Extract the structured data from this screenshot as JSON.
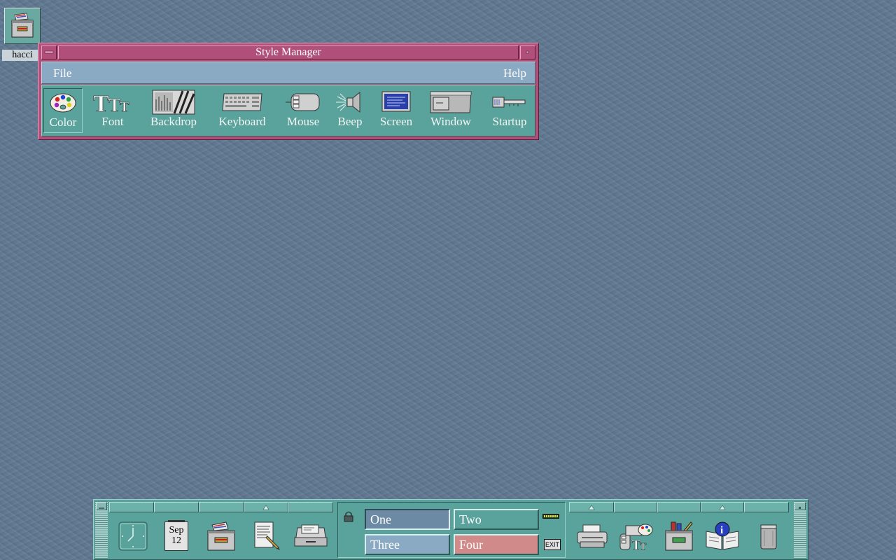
{
  "desktop": {
    "icon": {
      "label": "hacci",
      "icon_name": "file-cabinet-icon"
    }
  },
  "style_manager": {
    "title": "Style Manager",
    "menu": {
      "file": "File",
      "help": "Help"
    },
    "tools": [
      {
        "key": "color",
        "label": "Color",
        "icon_name": "palette-icon",
        "selected": true
      },
      {
        "key": "font",
        "label": "Font",
        "icon_name": "font-ttt-icon",
        "glyph": "TTT"
      },
      {
        "key": "backdrop",
        "label": "Backdrop",
        "icon_name": "backdrop-icon"
      },
      {
        "key": "keyboard",
        "label": "Keyboard",
        "icon_name": "keyboard-icon"
      },
      {
        "key": "mouse",
        "label": "Mouse",
        "icon_name": "mouse-icon"
      },
      {
        "key": "beep",
        "label": "Beep",
        "icon_name": "speaker-icon"
      },
      {
        "key": "screen",
        "label": "Screen",
        "icon_name": "monitor-screen-icon"
      },
      {
        "key": "window",
        "label": "Window",
        "icon_name": "window-icon"
      },
      {
        "key": "startup",
        "label": "Startup",
        "icon_name": "key-icon"
      }
    ],
    "colors": {
      "frame": "#b04f79",
      "menubar": "#8aa9c2",
      "body": "#5aa39c"
    }
  },
  "front_panel": {
    "left_controls": [
      {
        "name": "clock-icon"
      },
      {
        "name": "calendar-icon",
        "month": "Sep",
        "day": "12"
      },
      {
        "name": "file-manager-icon"
      },
      {
        "name": "text-editor-icon"
      },
      {
        "name": "mailbox-icon"
      }
    ],
    "workspaces": [
      {
        "label": "One",
        "color": "#6c8aa4",
        "active": true
      },
      {
        "label": "Two",
        "color": "#5aa39c"
      },
      {
        "label": "Three",
        "color": "#8aa9c2"
      },
      {
        "label": "Four",
        "color": "#d08a8a"
      }
    ],
    "exit_label": "EXIT",
    "right_controls": [
      {
        "name": "printer-icon"
      },
      {
        "name": "style-manager-icon",
        "glyph": "TT"
      },
      {
        "name": "application-manager-icon"
      },
      {
        "name": "help-manager-icon",
        "glyph": "i"
      },
      {
        "name": "trash-can-icon"
      }
    ]
  }
}
